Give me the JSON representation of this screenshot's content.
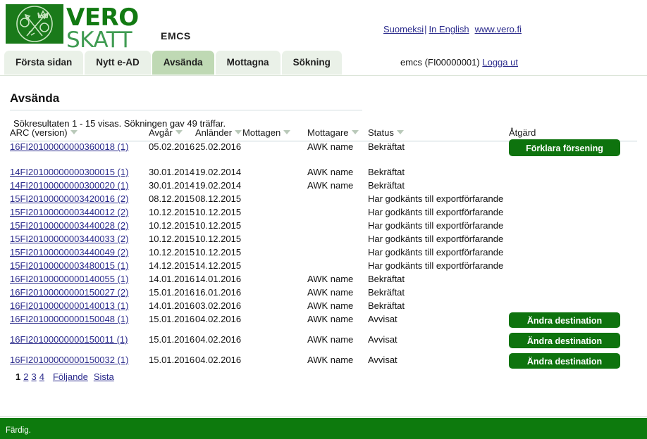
{
  "header": {
    "logo_vero": "VERO",
    "logo_skatt": "SKATT",
    "logo_icon": "vero-skatt-coat-of-arms",
    "app_name": "EMCS",
    "links": {
      "finnish": "Suomeksi",
      "separator": "|",
      "english": "In English",
      "website": "www.vero.fi"
    },
    "user": {
      "account": "emcs (FI00000001)",
      "logout": "Logga ut"
    }
  },
  "tabs": [
    {
      "label": "Första sidan",
      "active": false
    },
    {
      "label": "Nytt e-AD",
      "active": false
    },
    {
      "label": "Avsända",
      "active": true
    },
    {
      "label": "Mottagna",
      "active": false
    },
    {
      "label": "Sökning",
      "active": false
    }
  ],
  "main": {
    "title": "Avsända",
    "result_info": "Sökresultaten 1 - 15 visas. Sökningen gav 49 träffar."
  },
  "table": {
    "columns": [
      {
        "key": "arc",
        "label": "ARC (version)",
        "sortable": true
      },
      {
        "key": "avgar",
        "label": "Avgår",
        "sortable": true
      },
      {
        "key": "anlander",
        "label": "Anländer",
        "sortable": true
      },
      {
        "key": "mottagen",
        "label": "Mottagen",
        "sortable": true
      },
      {
        "key": "mottagare",
        "label": "Mottagare",
        "sortable": true
      },
      {
        "key": "status",
        "label": "Status",
        "sortable": true
      },
      {
        "key": "atgard",
        "label": "Åtgärd",
        "sortable": false
      }
    ],
    "rows": [
      {
        "arc": "16FI20100000000360018 (1)",
        "avgar": "05.02.2016",
        "anlander": "25.02.2016",
        "mottagen": "",
        "mottagare": "AWK name",
        "status": "Bekräftat",
        "action": "Förklara försening"
      },
      {
        "arc": "14FI20100000000300015 (1)",
        "avgar": "30.01.2014",
        "anlander": "19.02.2014",
        "mottagen": "",
        "mottagare": "AWK name",
        "status": "Bekräftat",
        "action": ""
      },
      {
        "arc": "14FI20100000000300020 (1)",
        "avgar": "30.01.2014",
        "anlander": "19.02.2014",
        "mottagen": "",
        "mottagare": "AWK name",
        "status": "Bekräftat",
        "action": ""
      },
      {
        "arc": "15FI20100000003420016 (2)",
        "avgar": "08.12.2015",
        "anlander": "08.12.2015",
        "mottagen": "",
        "mottagare": "",
        "status": "Har godkänts till exportförfarande",
        "action": ""
      },
      {
        "arc": "15FI20100000003440012 (2)",
        "avgar": "10.12.2015",
        "anlander": "10.12.2015",
        "mottagen": "",
        "mottagare": "",
        "status": "Har godkänts till exportförfarande",
        "action": ""
      },
      {
        "arc": "15FI20100000003440028 (2)",
        "avgar": "10.12.2015",
        "anlander": "10.12.2015",
        "mottagen": "",
        "mottagare": "",
        "status": "Har godkänts till exportförfarande",
        "action": ""
      },
      {
        "arc": "15FI20100000003440033 (2)",
        "avgar": "10.12.2015",
        "anlander": "10.12.2015",
        "mottagen": "",
        "mottagare": "",
        "status": "Har godkänts till exportförfarande",
        "action": ""
      },
      {
        "arc": "15FI20100000003440049 (2)",
        "avgar": "10.12.2015",
        "anlander": "10.12.2015",
        "mottagen": "",
        "mottagare": "",
        "status": "Har godkänts till exportförfarande",
        "action": ""
      },
      {
        "arc": "15FI20100000003480015 (1)",
        "avgar": "14.12.2015",
        "anlander": "14.12.2015",
        "mottagen": "",
        "mottagare": "",
        "status": "Har godkänts till exportförfarande",
        "action": ""
      },
      {
        "arc": "16FI20100000000140055 (1)",
        "avgar": "14.01.2016",
        "anlander": "14.01.2016",
        "mottagen": "",
        "mottagare": "AWK name",
        "status": "Bekräftat",
        "action": ""
      },
      {
        "arc": "16FI20100000000150027 (2)",
        "avgar": "15.01.2016",
        "anlander": "16.01.2016",
        "mottagen": "",
        "mottagare": "AWK name",
        "status": "Bekräftat",
        "action": ""
      },
      {
        "arc": "16FI20100000000140013 (1)",
        "avgar": "14.01.2016",
        "anlander": "03.02.2016",
        "mottagen": "",
        "mottagare": "AWK name",
        "status": "Bekräftat",
        "action": ""
      },
      {
        "arc": "16FI20100000000150048 (1)",
        "avgar": "15.01.2016",
        "anlander": "04.02.2016",
        "mottagen": "",
        "mottagare": "AWK name",
        "status": "Avvisat",
        "action": "Ändra destination"
      },
      {
        "arc": "16FI20100000000150011 (1)",
        "avgar": "15.01.2016",
        "anlander": "04.02.2016",
        "mottagen": "",
        "mottagare": "AWK name",
        "status": "Avvisat",
        "action": "Ändra destination"
      },
      {
        "arc": "16FI20100000000150032 (1)",
        "avgar": "15.01.2016",
        "anlander": "04.02.2016",
        "mottagen": "",
        "mottagare": "AWK name",
        "status": "Avvisat",
        "action": "Ändra destination"
      }
    ]
  },
  "pagination": {
    "pages": [
      {
        "label": "1",
        "current": true
      },
      {
        "label": "2",
        "current": false
      },
      {
        "label": "3",
        "current": false
      },
      {
        "label": "4",
        "current": false
      }
    ],
    "next": "Följande",
    "last": "Sista"
  },
  "statusbar": {
    "text": "Färdig."
  },
  "colors": {
    "brand_green": "#127a12",
    "button_green": "#0e730e",
    "tab_active": "#bfd9b4",
    "tab_inactive": "#eaf1e8",
    "link_blue": "#2b2b8c",
    "statusbar_green": "#0d7a0d"
  }
}
